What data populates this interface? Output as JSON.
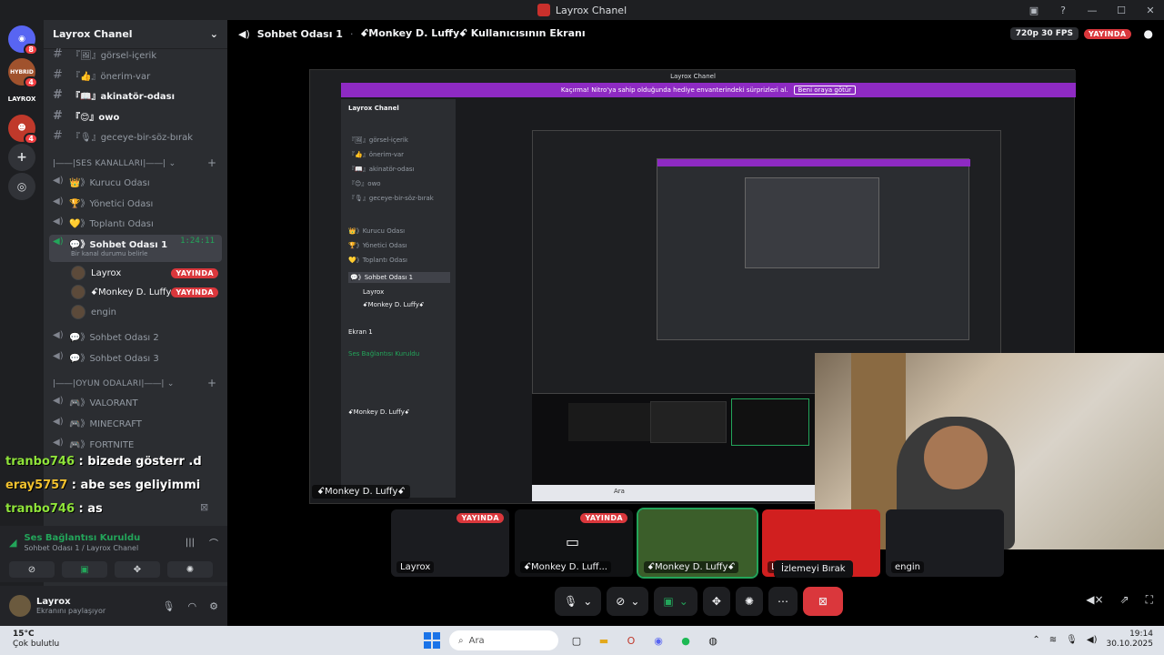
{
  "window": {
    "title": "Layrox Chanel"
  },
  "servers": [
    {
      "label": "",
      "badge": "8"
    },
    {
      "label": "HYBRID",
      "badge": "4"
    },
    {
      "label": "LAYROX",
      "badge": ""
    },
    {
      "label": "",
      "badge": "4"
    }
  ],
  "sidebar": {
    "server_name": "Layrox Chanel",
    "text_channels": [
      {
        "name": "『🖼』görsel-içerik"
      },
      {
        "name": "『👍』önerim-var"
      },
      {
        "name": "『📖』akinatör-odası"
      },
      {
        "name": "『😊』owo"
      },
      {
        "name": "『🎙』geceye-bir-söz-bırak"
      }
    ],
    "voice_category": "|――|SES KANALLARI|――|",
    "voice_channels": [
      {
        "name": "👑》Kurucu Odası"
      },
      {
        "name": "🏆》Yönetici Odası"
      },
      {
        "name": "💛》Toplantı Odası"
      }
    ],
    "active_channel": {
      "name": "💬》Sohbet Odası 1",
      "timer": "1:24:11",
      "status": "Bir kanal durumu belirle"
    },
    "members": [
      {
        "name": "Layrox",
        "badge": "YAYINDA"
      },
      {
        "name": "ꗃMonkey D. Luffyꗃ",
        "badge": "YAYINDA"
      },
      {
        "name": "engin",
        "badge": ""
      }
    ],
    "more_voice": [
      {
        "name": "💬》Sohbet Odası 2"
      },
      {
        "name": "💬》Sohbet Odası 3"
      }
    ],
    "game_category": "|――|OYUN ODALARI|――|",
    "game_channels": [
      {
        "name": "🎮》VALORANT"
      },
      {
        "name": "🎮》MINECRAFT"
      },
      {
        "name": "🎮》FORTNITE"
      }
    ]
  },
  "chat_overlay": [
    {
      "user": "tranbo746",
      "msg": " : bizede gösterr .d"
    },
    {
      "user": "eray5757",
      "msg": " : abe ses geliyimmi"
    },
    {
      "user": "tranbo746",
      "msg": " : as"
    }
  ],
  "voice_panel": {
    "status": "Ses Bağlantısı Kuruldu",
    "sub": "Sohbet Odası 1 / Layrox Chanel"
  },
  "user_panel": {
    "name": "Layrox",
    "status": "Ekranını paylaşıyor"
  },
  "stage_header": {
    "channel": "Sohbet Odası 1",
    "screen_of": "ꗃMonkey D. Luffyꗃ Kullanıcısının Ekranı",
    "quality": "720p 30 FPS",
    "live": "YAYINDA"
  },
  "shared_screen": {
    "title": "Layrox Chanel",
    "nitro_text": "Kaçırma! Nitro'ya sahip olduğunda hediye envanterindeki sürprizleri al.",
    "nitro_button": "Beni oraya götür",
    "label": "ꗃMonkey D. Luffyꗃ"
  },
  "tiles": [
    {
      "name": "Layrox",
      "badge": "YAYINDA"
    },
    {
      "name": "ꗃMonkey D. Luff...",
      "badge": "YAYINDA"
    },
    {
      "name": "ꗃMonkey D. Luffyꗃ",
      "badge": ""
    },
    {
      "name": "L",
      "badge": ""
    },
    {
      "name": "engin",
      "badge": ""
    }
  ],
  "tooltip": "İzlemeyi Bırak",
  "taskbar": {
    "temp": "15°C",
    "weather": "Çok bulutlu",
    "search": "Ara",
    "time": "19:14",
    "date": "30.10.2025"
  }
}
